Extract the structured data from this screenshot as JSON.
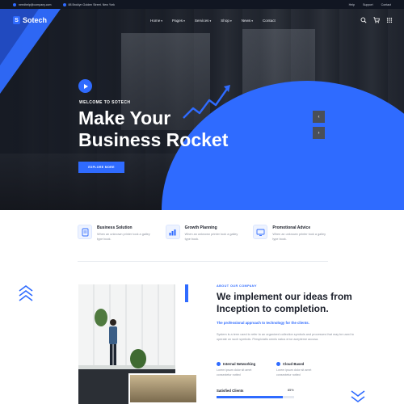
{
  "topbar": {
    "email": "needhelp@company.com",
    "address": "88 Broklyn Golden Street. New York",
    "links": [
      "Help",
      "Support",
      "Contact"
    ]
  },
  "brand": {
    "logo_letter": "S",
    "name": "Sotech",
    "accent": "#2f6bff",
    "dark": "#111622"
  },
  "nav": {
    "items": [
      {
        "label": "Home",
        "caret": "▾"
      },
      {
        "label": "Pages",
        "caret": "▾"
      },
      {
        "label": "Services",
        "caret": "▾"
      },
      {
        "label": "Shop",
        "caret": "▾"
      },
      {
        "label": "News",
        "caret": "▾"
      },
      {
        "label": "Contact",
        "caret": ""
      }
    ],
    "icons": [
      "search-icon",
      "cart-icon",
      "menu-grid-icon"
    ]
  },
  "hero": {
    "kicker": "WELCOME TO SOTECH",
    "title": "Make Your Business Rocket",
    "button": "EXPLORE MORE",
    "prev": "‹",
    "next": "›"
  },
  "features": [
    {
      "title": "Business Solution",
      "text": "When an unknown printer took a galley type book.",
      "icon": "business-solution-icon"
    },
    {
      "title": "Growth Planning",
      "text": "When an unknown printer took a galley type book.",
      "icon": "growth-planning-icon"
    },
    {
      "title": "Promotional Advice",
      "text": "When an unknown printer took a galley type book.",
      "icon": "promotional-advice-icon"
    }
  ],
  "about": {
    "kicker": "ABOUT OUR COMPANY",
    "title": "We implement our ideas from Inception to completion.",
    "subtitle": "The professional approach to technology for the clients.",
    "paragraph": "System is a term used to refer to an organized collection symbols and processes that may be used to operate on such symbols. Perspiciatis omnis natus error acepteme accusa.",
    "checks": [
      {
        "title": "Internal Networking",
        "text": "Lorem ipsum dolor sit amet consectetur notted"
      },
      {
        "title": "Cloud Based",
        "text": "Lorem ipsum dolor sit amet consectetur notted"
      }
    ],
    "progress": {
      "label": "Satisfied Clients",
      "value_text": "85%",
      "value": 0.85
    }
  }
}
